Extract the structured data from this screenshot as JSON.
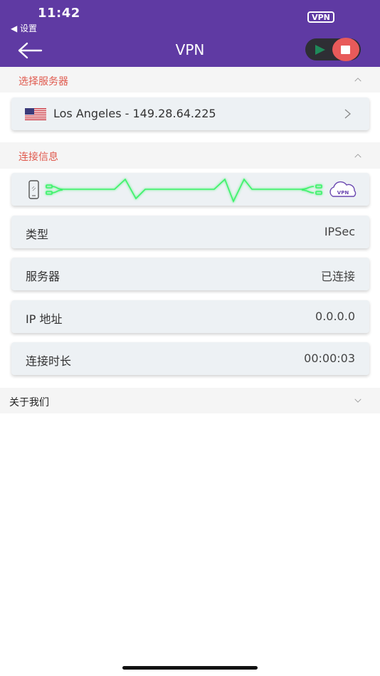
{
  "status_bar": {
    "time": "11:42",
    "back_app": "◀ 设置",
    "vpn_badge": "VPN"
  },
  "nav": {
    "title": "VPN"
  },
  "server_section": {
    "title": "选择服务器",
    "server": "Los Angeles - 149.28.64.225"
  },
  "connection_section": {
    "title": "连接信息",
    "rows": [
      {
        "label": "类型",
        "value": "IPSec"
      },
      {
        "label": "服务器",
        "value": "已连接"
      },
      {
        "label": "IP 地址",
        "value": "0.0.0.0"
      },
      {
        "label": "连接时长",
        "value": "00:00:03"
      }
    ],
    "cloud_label": "VPN"
  },
  "about_section": {
    "title": "关于我们"
  },
  "colors": {
    "header": "#5f3aa3",
    "accent_red": "#e05a4e",
    "pulse_green": "#3cf26a",
    "stop_button": "#e85a5a"
  }
}
